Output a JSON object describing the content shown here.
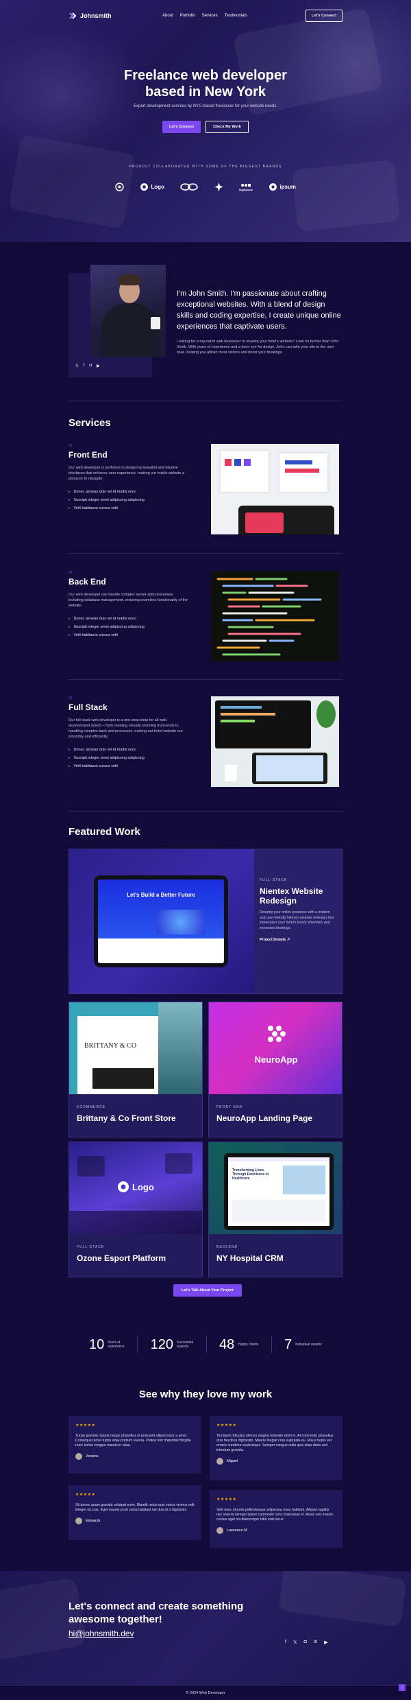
{
  "nav": {
    "logo": "Johnsmith",
    "links": [
      "About",
      "Portfolio",
      "Services",
      "Testimonials"
    ],
    "cta": "Let's Connect"
  },
  "hero": {
    "title_line1": "Freelance web developer",
    "title_line2": "based in New York",
    "subtitle": "Expert development services by NYC-based freelancer for your website needs.",
    "primary_btn": "Let's Connect",
    "secondary_btn": "Check My Work",
    "collab": "PROUDLY COLLABORATED WITH SOME OF THE BIGGEST BRANDS",
    "brands": [
      "",
      "Logo",
      "",
      "",
      "logoipsum",
      "ipsum"
    ]
  },
  "about": {
    "headline": "I'm John Smith. I'm passionate about crafting exceptional websites. With a blend of design skills and coding expertise, I create unique online experiences that captivate users.",
    "body": "Looking for a top-notch web developer to revamp your hotel's website? Look no further than John Smith. With years of experience and a keen eye for design, John can take your site to the next level, helping you attract more visitors and boost your bookings.",
    "socials": [
      "twitter",
      "facebook",
      "instagram",
      "youtube"
    ]
  },
  "services": {
    "title": "Services",
    "items": [
      {
        "num": "01",
        "title": "Front End",
        "desc": "Our web developer is proficient in designing beautiful and intuitive interfaces that enhance user experience, making our hotels website a pleasure to navigate.",
        "points": [
          "Donec aenean duis vel id mattis nunc",
          "Suscipit integer amet adipiscing adipiscing",
          "Velit habitasse cursus velit"
        ]
      },
      {
        "num": "02",
        "title": "Back End",
        "desc": "Our web developer can handle complex server-side processes including database management, ensuring seamless functionality of the website.",
        "points": [
          "Donec aenean duis vel id mattis nunc",
          "Suscipit integer amet adipiscing adipiscing",
          "Velit habitasse cursus velit"
        ]
      },
      {
        "num": "03",
        "title": "Full Stack",
        "desc": "Our full stack web developer is a one-stop-shop for all web development needs – from creating visually stunning front-ends to handling complex back end processes, making our hotel website run smoothly and efficiently.",
        "points": [
          "Donec aenean duis vel id mattis nunc",
          "Suscipit integer amet adipiscing adipiscing",
          "Velit habitasse cursus velit"
        ]
      }
    ]
  },
  "featured": {
    "title": "Featured Work",
    "main": {
      "tag": "FULL-STACK",
      "title": "Nientex Website Redesign",
      "desc": "Revamp your online presence with a modern and user-friendly Nientex website redesign that showcases your hotel's luxury amenities and increases bookings.",
      "link": "Project Details ↗",
      "screen_title": "Let's Build a Better Future"
    },
    "cards": [
      {
        "tag": "ECOMMERCE",
        "title": "Brittany & Co Front Store",
        "pic_text": "BRITTANY & CO"
      },
      {
        "tag": "FRONT END",
        "title": "NeuroApp Landing Page",
        "pic_text": "NeuroApp"
      },
      {
        "tag": "FULL-STACK",
        "title": "Ozone Esport Platform",
        "pic_text": "Logo"
      },
      {
        "tag": "BACKEND",
        "title": "NY Hospital CRM",
        "pic_text": "Transforming Lives Through Excellence in Healthcare"
      }
    ],
    "cta": "Let's Talk About Your Project"
  },
  "stats": [
    {
      "num": "10",
      "label1": "Years of",
      "label2": "experience"
    },
    {
      "num": "120",
      "label1": "Successful",
      "label2": "projects"
    },
    {
      "num": "48",
      "label1": "Happy clients",
      "label2": ""
    },
    {
      "num": "7",
      "label1": "Individual awards",
      "label2": ""
    }
  ],
  "testimonials": {
    "title": "See why they love my work",
    "stars": "★★★★★",
    "items": [
      {
        "text": "Turpis gravida mauris neque phasellus et praesent ullamcorper a amet. Consequat amet turpis vitae pretium viverra. Platea non imperdiet fringilla nunc lectus congue mauris in vitae.",
        "name": "Jessica"
      },
      {
        "text": "Tincidunt ridiculus ultrices magna molestie enim in. At commodo phasellus duis faucibus dignissim. Mauris feugiat cras vulputate eu. Risus turpis est ornare curabitur scelerisque. Semper congue nulla quis vitae diam sed interdum gravida.",
        "name": "Miguel"
      },
      {
        "text": "Sit donec quam gravida volutpat enim. Blandit netus quis varius viverra velit integer sit cras. Eget mauris proin porta habitant vel duis id a dignissim.",
        "name": "Edwards"
      },
      {
        "text": "Velit nunc lobortis pellentesque adipiscing risus habitant. Aliquet sagittis nec viverra semper ipsum commodo nunc maecenas et. Risus sed mauris cursus eget mi ullamcorper nibh erat lacus.",
        "name": "Lawrence M"
      }
    ]
  },
  "footer": {
    "headline": "Let's connect and create something awesome together!",
    "email": "hi@johnsmith.dev",
    "socials": [
      "facebook",
      "twitter",
      "instagram",
      "linkedin",
      "youtube"
    ],
    "copyright": "© 2024 Web Developer",
    "to_top": "↑"
  },
  "colors": {
    "accent": "#7a47f0",
    "background": "#120b3a",
    "card": "#231b5c",
    "stars": "#f6b100"
  }
}
